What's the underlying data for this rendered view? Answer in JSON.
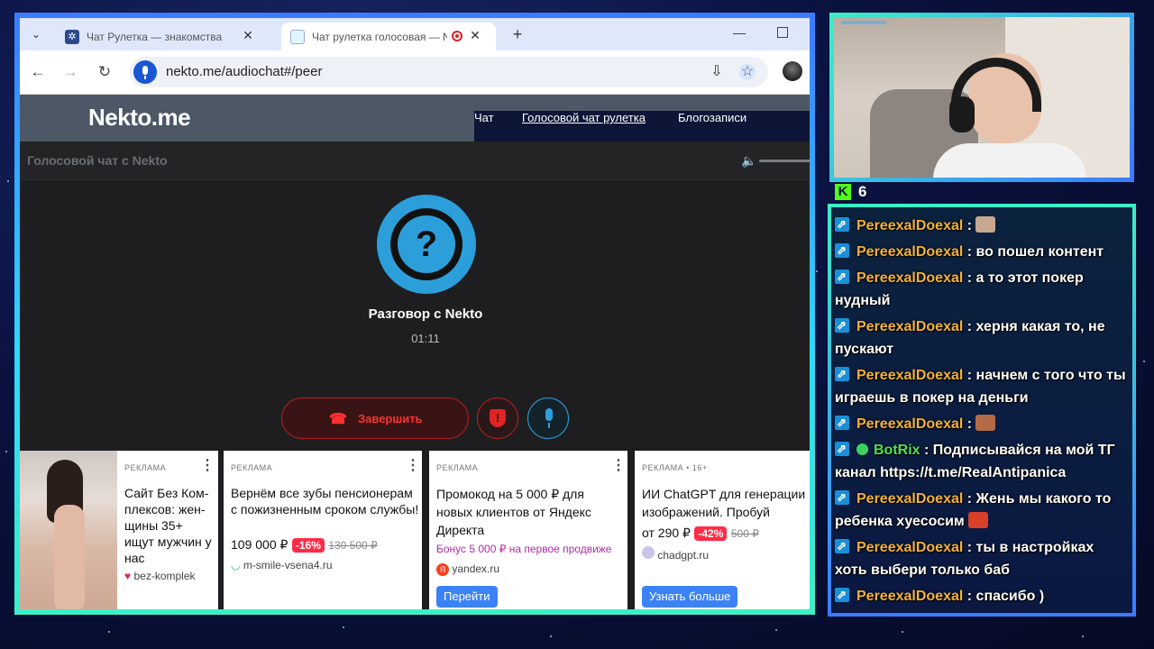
{
  "browser": {
    "tabs": [
      {
        "title": "Чат Рулетка — знакомства и общ",
        "active": false
      },
      {
        "title": "Чат рулетка голосовая — Ne",
        "active": true
      }
    ],
    "url": "nekto.me/audiochat#/peer"
  },
  "site": {
    "logo": "Nekto.me",
    "nav": [
      "Чат",
      "Голосовой чат рулетка",
      "Блогозаписи"
    ],
    "subheader_title": "Голосовой чат с Nekto",
    "avatar_glyph": "?",
    "conversation_title": "Разговор с Nekto",
    "timer": "01:11",
    "end_button": "Завершить",
    "shield_glyph": "!"
  },
  "ads": [
    {
      "label": "РЕКЛАМА",
      "title": "Сайт Без Ком-плексов: жен-щины 35+ ищут мужчин у нас",
      "domain": "bez-komplek"
    },
    {
      "label": "РЕКЛАМА",
      "title": "Вернём все зубы пенсионерам с пожизненным сроком службы!",
      "price": "109 000 ₽",
      "discount": "-16%",
      "old_price": "130 500 ₽",
      "domain": "m-smile-vsena4.ru"
    },
    {
      "label": "РЕКЛАМА",
      "title": "Промокод на 5 000 ₽ для новых клиентов от Яндекс Директа",
      "bonus": "Бонус 5 000 ₽ на первое продвиже",
      "domain": "yandex.ru",
      "cta": "Перейти"
    },
    {
      "label": "РЕКЛАМА • 16+",
      "title": "ИИ ChatGPT для генерации изображений. Пробуй",
      "price": "от 290 ₽",
      "discount": "-42%",
      "old_price": "500 ₽",
      "domain": "chadgpt.ru",
      "cta": "Узнать больше"
    }
  ],
  "stream": {
    "viewer_count": "6",
    "platform_logo": "K",
    "chat": [
      {
        "user": "PereexalDoexal",
        "text": ":",
        "emote": "cat"
      },
      {
        "user": "PereexalDoexal",
        "text": ": во пошел контент"
      },
      {
        "user": "PereexalDoexal",
        "text": ": а то этот покер нудный"
      },
      {
        "user": "PereexalDoexal",
        "text": ": херня какая то, не пускают"
      },
      {
        "user": "PereexalDoexal",
        "text": ": начнем с того что ты играешь в покер на деньги"
      },
      {
        "user": "PereexalDoexal",
        "text": ":",
        "emote": "face"
      },
      {
        "user": "BotRix",
        "text": ": Подписывайся на мой ТГ канал https://t.me/RealAntipanica",
        "verified": true
      },
      {
        "user": "PereexalDoexal",
        "text": ": Жень мы какого то ребенка хуесосим",
        "emote": "devil"
      },
      {
        "user": "PereexalDoexal",
        "text": ": ты в настройках хоть выбери только баб"
      },
      {
        "user": "PereexalDoexal",
        "text": ": спасибо )"
      }
    ]
  }
}
